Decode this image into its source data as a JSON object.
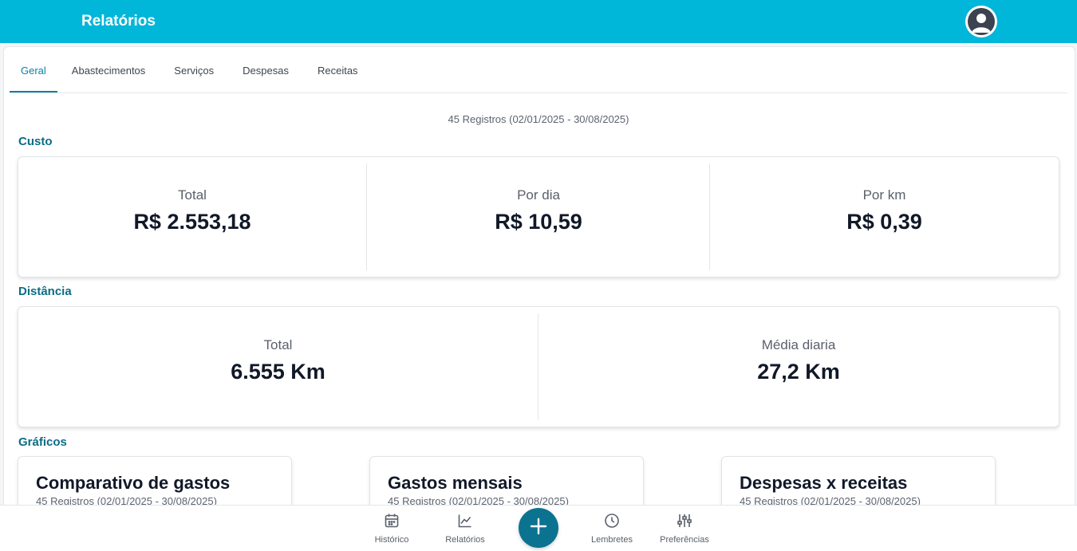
{
  "header": {
    "title": "Relatórios"
  },
  "tabs": [
    {
      "label": "Geral",
      "active": true
    },
    {
      "label": "Abastecimentos",
      "active": false
    },
    {
      "label": "Serviços",
      "active": false
    },
    {
      "label": "Despesas",
      "active": false
    },
    {
      "label": "Receitas",
      "active": false
    }
  ],
  "records_summary": "45 Registros (02/01/2025 - 30/08/2025)",
  "custo": {
    "title": "Custo",
    "stats": [
      {
        "label": "Total",
        "value": "R$ 2.553,18"
      },
      {
        "label": "Por dia",
        "value": "R$ 10,59"
      },
      {
        "label": "Por km",
        "value": "R$ 0,39"
      }
    ]
  },
  "distancia": {
    "title": "Distância",
    "stats": [
      {
        "label": "Total",
        "value": "6.555 Km"
      },
      {
        "label": "Média diaria",
        "value": "27,2 Km"
      }
    ]
  },
  "graficos": {
    "title": "Gráficos",
    "cards": [
      {
        "title": "Comparativo de gastos",
        "subtitle": "45 Registros (02/01/2025 - 30/08/2025)"
      },
      {
        "title": "Gastos mensais",
        "subtitle": "45 Registros (02/01/2025 - 30/08/2025)"
      },
      {
        "title": "Despesas x receitas",
        "subtitle": "45 Registros (02/01/2025 - 30/08/2025)"
      }
    ]
  },
  "bottom_nav": [
    {
      "label": "Histórico",
      "icon": "calendar-icon"
    },
    {
      "label": "Relatórios",
      "icon": "chart-line-icon"
    },
    {
      "label": "Lembretes",
      "icon": "clock-icon"
    },
    {
      "label": "Preferências",
      "icon": "sliders-icon"
    }
  ],
  "fab": {
    "icon": "plus-icon"
  },
  "colors": {
    "header_bg": "#00b6d9",
    "accent": "#0b7fa5",
    "section_title": "#0a6d85",
    "fab_bg": "#0b7390"
  }
}
